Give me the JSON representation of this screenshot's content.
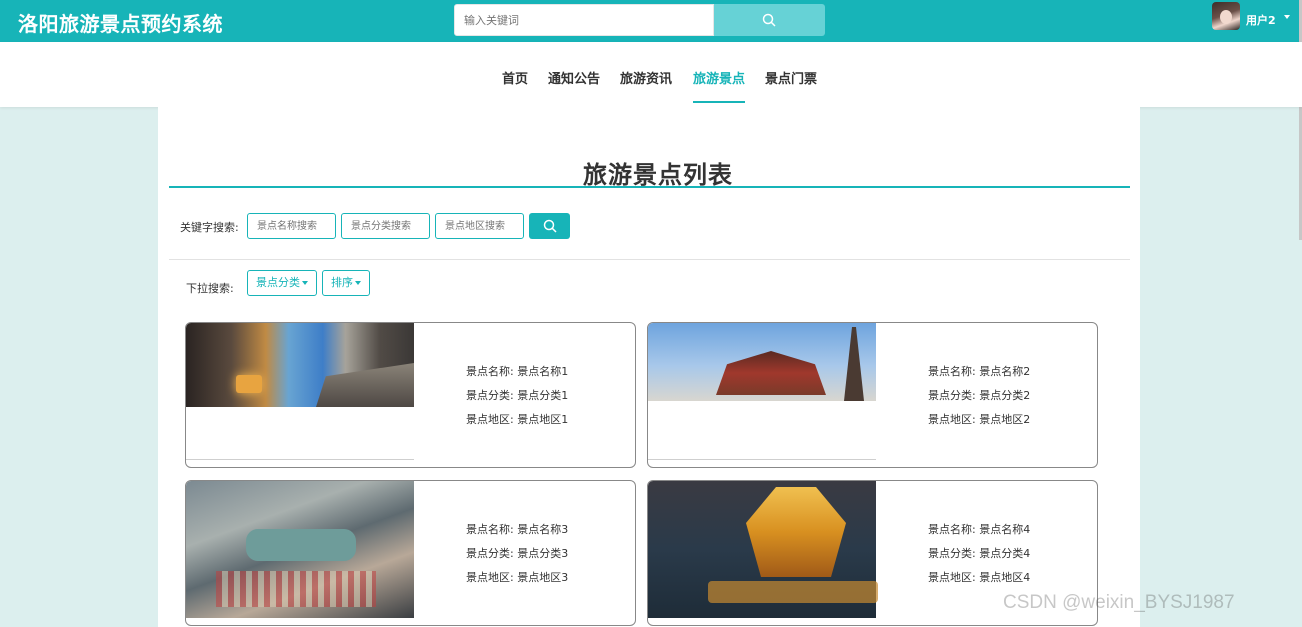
{
  "header": {
    "brand": "洛阳旅游景点预约系统",
    "search_placeholder": "输入关键词",
    "user_name": "用户2"
  },
  "nav": {
    "items": [
      "首页",
      "通知公告",
      "旅游资讯",
      "旅游景点",
      "景点门票"
    ],
    "active": "旅游景点"
  },
  "main": {
    "title": "旅游景点列表",
    "keyword_label": "关键字搜索:",
    "keyword_placeholders": {
      "name": "景点名称搜索",
      "category": "景点分类搜索",
      "region": "景点地区搜索"
    },
    "dropdown_label": "下拉搜索:",
    "dropdowns": [
      "景点分类",
      "排序"
    ]
  },
  "cards": [
    {
      "name_label": "景点名称:",
      "name": "景点名称1",
      "category_label": "景点分类:",
      "category": "景点分类1",
      "region_label": "景点地区:",
      "region": "景点地区1"
    },
    {
      "name_label": "景点名称:",
      "name": "景点名称2",
      "category_label": "景点分类:",
      "category": "景点分类2",
      "region_label": "景点地区:",
      "region": "景点地区2"
    },
    {
      "name_label": "景点名称:",
      "name": "景点名称3",
      "category_label": "景点分类:",
      "category": "景点分类3",
      "region_label": "景点地区:",
      "region": "景点地区3"
    },
    {
      "name_label": "景点名称:",
      "name": "景点名称4",
      "category_label": "景点分类:",
      "category": "景点分类4",
      "region_label": "景点地区:",
      "region": "景点地区4"
    }
  ],
  "watermark": "CSDN @weixin_BYSJ1987",
  "colors": {
    "accent": "#17b4b8",
    "page_bg": "#dcefee",
    "search_button": "#66d2d6"
  },
  "icons": [
    "search-icon",
    "chevron-down-icon"
  ]
}
